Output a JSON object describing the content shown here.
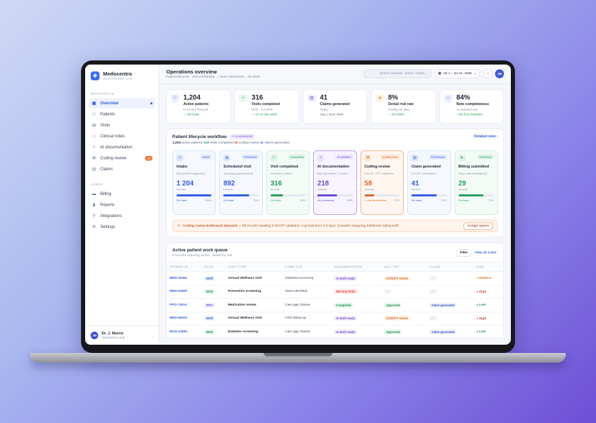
{
  "brand": {
    "name": "Medocentra",
    "subtitle": "HEALTHCARE OPS"
  },
  "sidebar": {
    "workspace_label": "WORKSPACE",
    "admin_label": "ADMIN",
    "items": [
      {
        "label": "Overview",
        "icon": "grid-icon",
        "active": true
      },
      {
        "label": "Patients",
        "icon": "users-icon"
      },
      {
        "label": "Visits",
        "icon": "calendar-icon"
      },
      {
        "label": "Clinical notes",
        "icon": "document-icon"
      },
      {
        "label": "AI documentation",
        "icon": "sparkle-icon"
      },
      {
        "label": "Coding review",
        "icon": "code-icon",
        "badge": "12"
      },
      {
        "label": "Claims",
        "icon": "receipt-icon"
      }
    ],
    "admin_items": [
      {
        "label": "Billing",
        "icon": "card-icon"
      },
      {
        "label": "Reports",
        "icon": "chart-icon"
      },
      {
        "label": "Integrations",
        "icon": "plug-icon"
      },
      {
        "label": "Settings",
        "icon": "gear-icon"
      }
    ],
    "user": {
      "initials": "JM",
      "name": "Dr. J. Morris",
      "role": "Operations Lead"
    }
  },
  "header": {
    "title": "Operations overview",
    "subtitle": "Patient lifecycle · visit scheduling → claim submission · Jul 2025",
    "search_placeholder": "Search patients, claims, codes...",
    "date_range": "Jul 1 – Jul 31, 2025",
    "avatar": "JM"
  },
  "stats": [
    {
      "value": "1,204",
      "label": "Active patients",
      "sub": "In current lifecycle",
      "trend": "↑ +36 today",
      "icon": "users-icon",
      "color": "#3b6ef5",
      "bg": "#eaf0ff"
    },
    {
      "value": "316",
      "label": "Visits completed",
      "sub": "MTD · Jul 2025",
      "trend": "↑ +12 vs last week",
      "icon": "check-icon",
      "color": "#23a15a",
      "bg": "#e7f7ee"
    },
    {
      "value": "41",
      "label": "Claims generated",
      "sub": "Today",
      "trend": "Avg 1.4d to claim",
      "trend_neutral": true,
      "icon": "receipt-icon",
      "color": "#6b46d9",
      "bg": "#f1ebff"
    },
    {
      "value": "8%",
      "label": "Denial risk rate",
      "sub": "Trailing 30 days",
      "trend": "↑ -2% MoM",
      "icon": "shield-icon",
      "color": "#e0812a",
      "bg": "#fff1e4"
    },
    {
      "value": "84%",
      "label": "Note completeness",
      "sub": "AI-assisted avg",
      "trend": "↑ 6% from baseline",
      "icon": "document-icon",
      "color": "#3b6ef5",
      "bg": "#eaf0ff"
    }
  ],
  "workflow": {
    "title": "Patient lifecycle workflow",
    "ai_badge": "✧ AI-monitored",
    "detailed_label": "Detailed view ›",
    "summary": [
      {
        "value": "1,204",
        "label": "active patients",
        "color": "#1d2433"
      },
      {
        "value": "316",
        "label": "visits completed",
        "color": "#23a15a"
      },
      {
        "value": "58",
        "label": "coding review",
        "color": "#e0642a"
      },
      {
        "value": "41",
        "label": "claims generated",
        "color": "#3b6ef5"
      }
    ],
    "stages": [
      {
        "name": "Intake",
        "badge": "Active",
        "desc": "New patient registration",
        "value": "1 204",
        "unit": "records",
        "status": "On track",
        "pct": "100%",
        "fill": 1.0,
        "color": "#2f5ce0",
        "bg": "#f5f8ff",
        "border": "#d6e2fb",
        "badge_bg": "#dfe8ff",
        "icon": "users-icon"
      },
      {
        "name": "Scheduled visit",
        "badge": "Scheduled",
        "desc": "Upcoming appointments",
        "value": "892",
        "unit": "records",
        "status": "On track",
        "pct": "74%",
        "fill": 0.74,
        "color": "#2f5ce0",
        "bg": "#f5f8ff",
        "border": "#d6e2fb",
        "badge_bg": "#dfe8ff",
        "icon": "calendar-icon"
      },
      {
        "name": "Visit completed",
        "badge": "Completed",
        "desc": "Encounter closed",
        "value": "316",
        "unit": "records",
        "status": "On track",
        "pct": "35%",
        "fill": 0.35,
        "color": "#23a15a",
        "bg": "#f3fbf6",
        "border": "#cdebd9",
        "badge_bg": "#dcf3e6",
        "icon": "check-icon"
      },
      {
        "name": "AI documentation",
        "badge": "AI assisted",
        "desc": "Note generation · review",
        "value": "218",
        "unit": "records",
        "status": "AI processing",
        "pct": "55%",
        "fill": 0.55,
        "color": "#6b46d9",
        "bg": "#f7f3ff",
        "border": "#b99cf2",
        "badge_bg": "#ece3ff",
        "icon": "sparkle-icon"
      },
      {
        "name": "Coding review",
        "badge": "● Bottleneck",
        "desc": "ICD-10 · CPT validation",
        "value": "58",
        "unit": "records",
        "status": "⚠ Needs attention",
        "pct": "27%",
        "fill": 0.27,
        "color": "#e0642a",
        "bg": "#fff6ef",
        "border": "#f3b48d",
        "badge_bg": "#ffe6d6",
        "icon": "code-icon"
      },
      {
        "name": "Claim generated",
        "badge": "Processing",
        "desc": "EDI 837 submission",
        "value": "41",
        "unit": "records",
        "status": "On track",
        "pct": "71%",
        "fill": 0.71,
        "color": "#2f5ce0",
        "bg": "#f5f8ff",
        "border": "#d6e2fb",
        "badge_bg": "#dfe8ff",
        "icon": "receipt-icon"
      },
      {
        "name": "Billing submitted",
        "badge": "Submitted",
        "desc": "Payer acknowledgment",
        "value": "29",
        "unit": "records",
        "status": "On track",
        "pct": "71%",
        "fill": 0.71,
        "color": "#23a15a",
        "bg": "#f3fbf6",
        "border": "#cdebd9",
        "badge_bg": "#dcf3e6",
        "icon": "send-icon"
      }
    ],
    "alert": {
      "title": "Coding review bottleneck detected",
      "text": " — 58 records awaiting ICD/CPT validation. Avg hold time: 2.3 days. Consider assigning additional coding staff.",
      "button": "Assign queue"
    }
  },
  "queue": {
    "title": "Active patient work queue",
    "subtitle": "6 records requiring action · sorted by risk",
    "filter": "Filter",
    "view_all": "View all 1,204 ›",
    "columns": [
      "PATIENT ID",
      "PLAN",
      "VISIT TYPE",
      "CARE GAP",
      "DOCUMENTATION",
      "ICD / CPT",
      "CLAIM",
      "RISK"
    ],
    "rows": [
      {
        "id": "MED-20491",
        "plan": "MCR",
        "visit": "Annual Wellness Visit",
        "gap": "Diabetes screening",
        "doc": "AI draft ready",
        "icd": "ICD/CPT review",
        "claim": "–",
        "risk": "Medium"
      },
      {
        "id": "MED-51820",
        "plan": "MCD",
        "visit": "Preventive screening",
        "gap": "None identified",
        "doc": "Missing fields",
        "icd": "–",
        "claim": "–",
        "risk": "High"
      },
      {
        "id": "PPO-73914",
        "plan": "PPO",
        "visit": "Medication review",
        "gap": "Care gap closure",
        "doc": "Completed",
        "icd": "Approved",
        "claim": "Claim generated",
        "risk": "Low"
      },
      {
        "id": "MED-66203",
        "plan": "MCR",
        "visit": "Annual Wellness Visit",
        "gap": "HTN follow-up",
        "doc": "AI draft ready",
        "icd": "ICD/CPT review",
        "claim": "–",
        "risk": "High"
      },
      {
        "id": "MCD-14552",
        "plan": "MCD",
        "visit": "Diabetes screening",
        "gap": "Care gap closure",
        "doc": "AI draft ready",
        "icd": "Approved",
        "claim": "Claim generated",
        "risk": "Low"
      }
    ]
  }
}
